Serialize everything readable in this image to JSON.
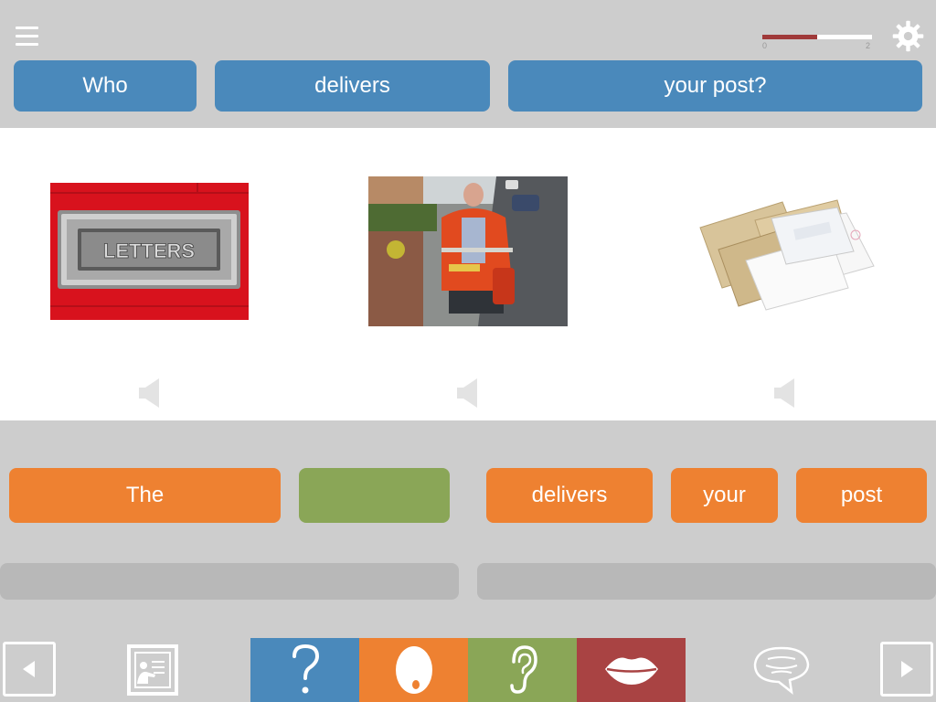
{
  "header": {
    "menu_icon": "hamburger-menu-icon",
    "settings_icon": "gear-icon",
    "progress": {
      "min_label": "0",
      "max_label": "2",
      "fraction": 0.5,
      "fill_color": "#a03a3a"
    }
  },
  "question": {
    "words": [
      "Who",
      "delivers",
      "your post?"
    ],
    "color": "#4a89bb"
  },
  "pictures": [
    {
      "name": "letterbox-photo",
      "description_icon": "letter-plate-image",
      "letter_plate_text": "LETTERS"
    },
    {
      "name": "postman-photo",
      "description_icon": "postman-image"
    },
    {
      "name": "envelopes-photo",
      "description_icon": "envelopes-image"
    }
  ],
  "answer": {
    "words": [
      "The",
      "",
      "delivers",
      "your",
      "post"
    ],
    "colors": {
      "word": "#ee8131",
      "blank": "#8aa657"
    }
  },
  "toolbar": {
    "icons": [
      "back-arrow-icon",
      "teacher-board-icon",
      "question-mark-icon",
      "egg-face-icon",
      "ear-icon",
      "lips-icon",
      "speech-bubble-icon",
      "forward-arrow-icon"
    ],
    "colors": {
      "question": "#4a89bb",
      "egg": "#ee8131",
      "ear": "#8aa657",
      "lips": "#a94343"
    }
  }
}
